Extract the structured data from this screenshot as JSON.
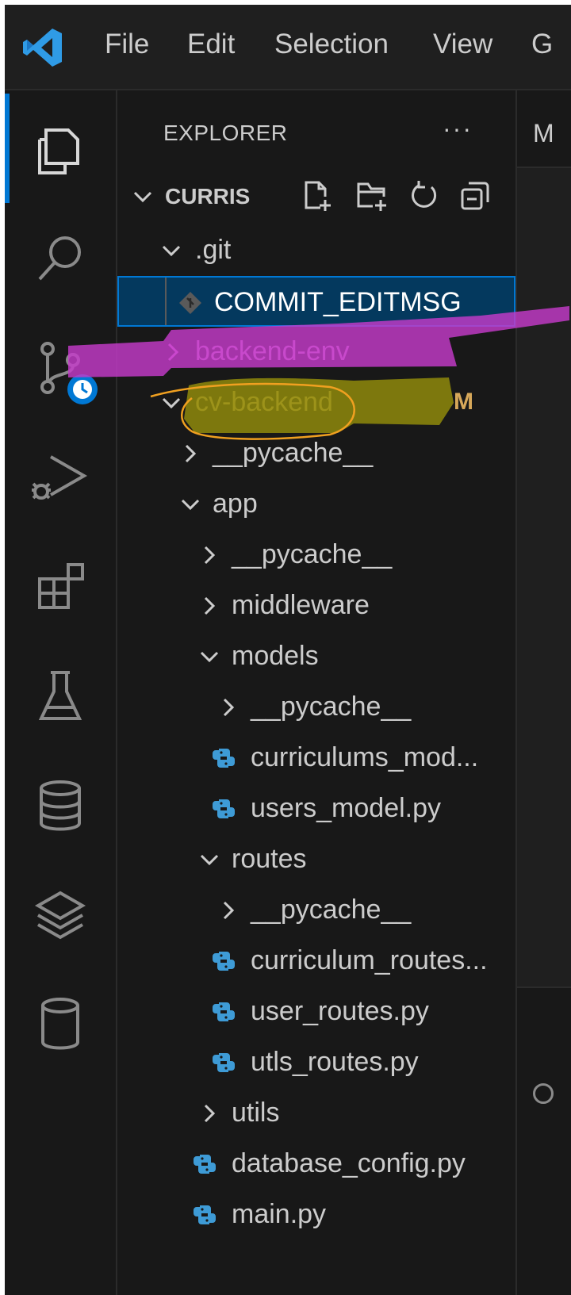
{
  "menu": {
    "file": "File",
    "edit": "Edit",
    "selection": "Selection",
    "view": "View",
    "go_partial": "G"
  },
  "sidebar": {
    "title": "EXPLORER",
    "more": "···",
    "section_title": "CURRIS"
  },
  "tree": {
    "git_folder": ".git",
    "commit_file": "COMMIT_EDITMSG",
    "backend_env": "backend-env",
    "cv_backend": "cv-backend",
    "cv_backend_badge": "M",
    "pycache_root": "__pycache__",
    "app": "app",
    "app_pycache": "__pycache__",
    "middleware": "middleware",
    "models": "models",
    "models_pycache": "__pycache__",
    "curriculums_model": "curriculums_mod...",
    "users_model": "users_model.py",
    "routes": "routes",
    "routes_pycache": "__pycache__",
    "curriculum_routes": "curriculum_routes...",
    "user_routes": "user_routes.py",
    "utls_routes": "utls_routes.py",
    "utils": "utils",
    "database_config": "database_config.py",
    "main": "main.py"
  },
  "editor": {
    "tab_initial": "M"
  },
  "colors": {
    "accent": "#0078d4",
    "selection_bg": "#04395e",
    "python_icon": "#3e9bd6",
    "modified": "#d7a85a",
    "magenta_highlight": "#c43bc9",
    "olive_highlight": "#8f8a0c",
    "orange_circle": "#f0a020"
  },
  "icons": {
    "activity": [
      "explorer-icon",
      "search-icon",
      "source-control-icon",
      "run-debug-icon",
      "extensions-icon",
      "testing-icon",
      "database-icon",
      "layers-icon",
      "cylinder-icon"
    ],
    "section_actions": [
      "new-file-icon",
      "new-folder-icon",
      "refresh-icon",
      "collapse-all-icon"
    ]
  }
}
